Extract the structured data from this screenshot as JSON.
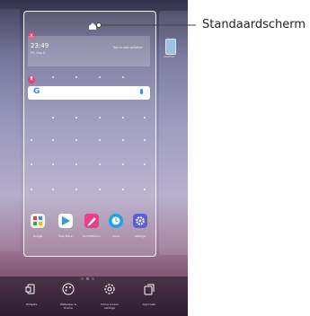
{
  "callout": {
    "label": "Standaardscherm"
  },
  "weather": {
    "time": "23:49",
    "date": "Fri, Sep 6",
    "tap_hint": "Tap to add weather"
  },
  "search": {
    "logo": "G"
  },
  "next_page": {
    "label": "Weather"
  },
  "dock": {
    "apps": [
      {
        "name": "Google",
        "icon": "google-folder-icon",
        "color": "#e8a838"
      },
      {
        "name": "Play Store",
        "icon": "play-store-icon",
        "color": "#ffffff"
      },
      {
        "name": "QuickMemo+",
        "icon": "quickmemo-icon",
        "color": "#e83e8c"
      },
      {
        "name": "Clock",
        "icon": "clock-icon",
        "color": "#1da1e6"
      },
      {
        "name": "Settings",
        "icon": "settings-icon",
        "color": "#5a5fd6"
      }
    ]
  },
  "toolbar": {
    "widgets": "Widgets",
    "wallpaper_line1": "Wallpaper &",
    "wallpaper_line2": "theme",
    "settings_line1": "Home screen",
    "settings_line2": "settings",
    "app_trash": "App trash"
  },
  "colors": {
    "remove_badge": "#e0416a",
    "google_blue": "#4285f4"
  }
}
